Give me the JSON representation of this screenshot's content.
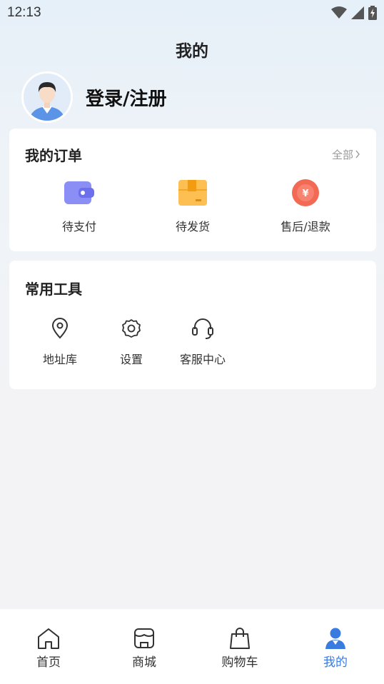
{
  "status": {
    "time": "12:13"
  },
  "header": {
    "title": "我的"
  },
  "profile": {
    "login_label": "登录/注册"
  },
  "orders": {
    "title": "我的订单",
    "all_label": "全部",
    "items": [
      {
        "label": "待支付",
        "icon": "wallet-icon",
        "color": "#7b7ff2"
      },
      {
        "label": "待发货",
        "icon": "package-icon",
        "color": "#fbb445"
      },
      {
        "label": "售后/退款",
        "icon": "yen-coin-icon",
        "color": "#f0604e"
      }
    ]
  },
  "tools": {
    "title": "常用工具",
    "items": [
      {
        "label": "地址库",
        "icon": "location-pin-icon"
      },
      {
        "label": "设置",
        "icon": "gear-icon"
      },
      {
        "label": "客服中心",
        "icon": "headset-icon"
      }
    ]
  },
  "tabbar": {
    "active_color": "#3a7be0",
    "items": [
      {
        "label": "首页",
        "icon": "home-icon",
        "active": false
      },
      {
        "label": "商城",
        "icon": "store-icon",
        "active": false
      },
      {
        "label": "购物车",
        "icon": "shopping-bag-icon",
        "active": false
      },
      {
        "label": "我的",
        "icon": "user-icon",
        "active": true
      }
    ]
  }
}
